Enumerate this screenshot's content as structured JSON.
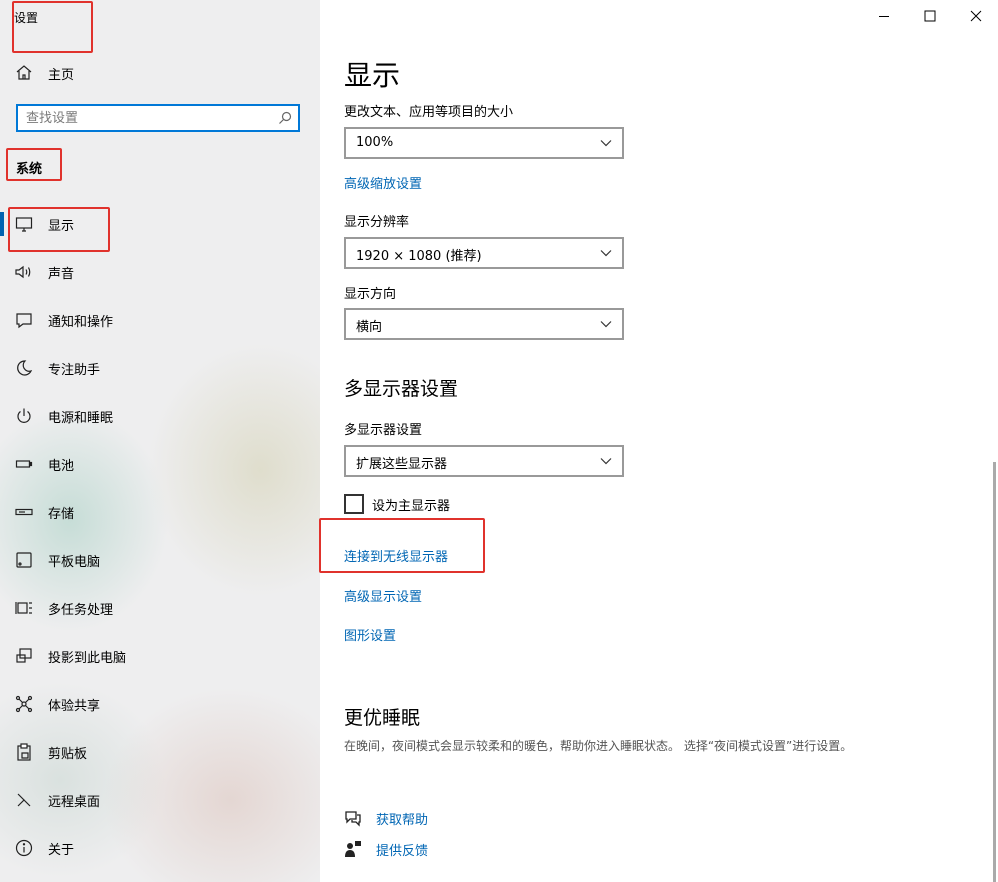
{
  "app": {
    "title": "设置"
  },
  "sidebar": {
    "home_label": "主页",
    "search_placeholder": "查找设置",
    "section_label": "系统",
    "items": [
      {
        "label": "显示",
        "icon": "monitor-icon",
        "active": true
      },
      {
        "label": "声音",
        "icon": "speaker-icon"
      },
      {
        "label": "通知和操作",
        "icon": "notification-icon"
      },
      {
        "label": "专注助手",
        "icon": "moon-icon"
      },
      {
        "label": "电源和睡眠",
        "icon": "power-icon"
      },
      {
        "label": "电池",
        "icon": "battery-icon"
      },
      {
        "label": "存储",
        "icon": "storage-icon"
      },
      {
        "label": "平板电脑",
        "icon": "tablet-icon"
      },
      {
        "label": "多任务处理",
        "icon": "multitask-icon"
      },
      {
        "label": "投影到此电脑",
        "icon": "project-icon"
      },
      {
        "label": "体验共享",
        "icon": "share-icon"
      },
      {
        "label": "剪贴板",
        "icon": "clipboard-icon"
      },
      {
        "label": "远程桌面",
        "icon": "remote-desktop-icon"
      },
      {
        "label": "关于",
        "icon": "info-icon"
      }
    ]
  },
  "main": {
    "title": "显示",
    "scale_label": "更改文本、应用等项目的大小",
    "scale_value": "100%",
    "advanced_scale_link": "高级缩放设置",
    "resolution_label": "显示分辨率",
    "resolution_value": "1920 × 1080 (推荐)",
    "orientation_label": "显示方向",
    "orientation_value": "横向",
    "multi_heading": "多显示器设置",
    "multi_label": "多显示器设置",
    "multi_value": "扩展这些显示器",
    "main_display_checkbox": "设为主显示器",
    "main_display_checked": false,
    "wireless_link": "连接到无线显示器",
    "advanced_display_link": "高级显示设置",
    "graphics_link": "图形设置",
    "sleep_heading": "更优睡眠",
    "sleep_desc": "在晚间，夜间模式会显示较柔和的暖色，帮助你进入睡眠状态。 选择“夜间模式设置”进行设置。",
    "help_link": "获取帮助",
    "feedback_link": "提供反馈"
  },
  "colors": {
    "accent": "#0078d7",
    "link": "#0066b4",
    "highlight_box": "#e0322c"
  }
}
